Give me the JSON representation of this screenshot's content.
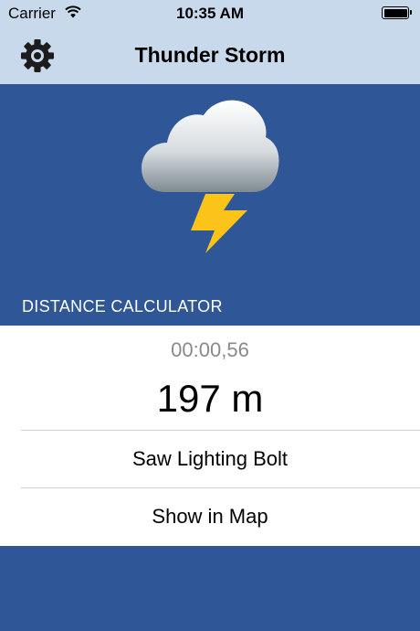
{
  "status_bar": {
    "carrier": "Carrier",
    "time": "10:35 AM"
  },
  "nav": {
    "title": "Thunder Storm",
    "settings_icon": "gear-icon"
  },
  "hero": {
    "weather_icon": "thunderstorm-icon",
    "section_header": "DISTANCE CALCULATOR"
  },
  "calculator": {
    "timer": "00:00,56",
    "distance": "197 m",
    "saw_bolt_label": "Saw Lighting Bolt",
    "show_map_label": "Show in Map"
  },
  "colors": {
    "background_blue": "#2f5696",
    "bar_light_blue": "#c8d9ec",
    "bolt_yellow": "#fcc419",
    "timer_gray": "#8a8a8a"
  }
}
